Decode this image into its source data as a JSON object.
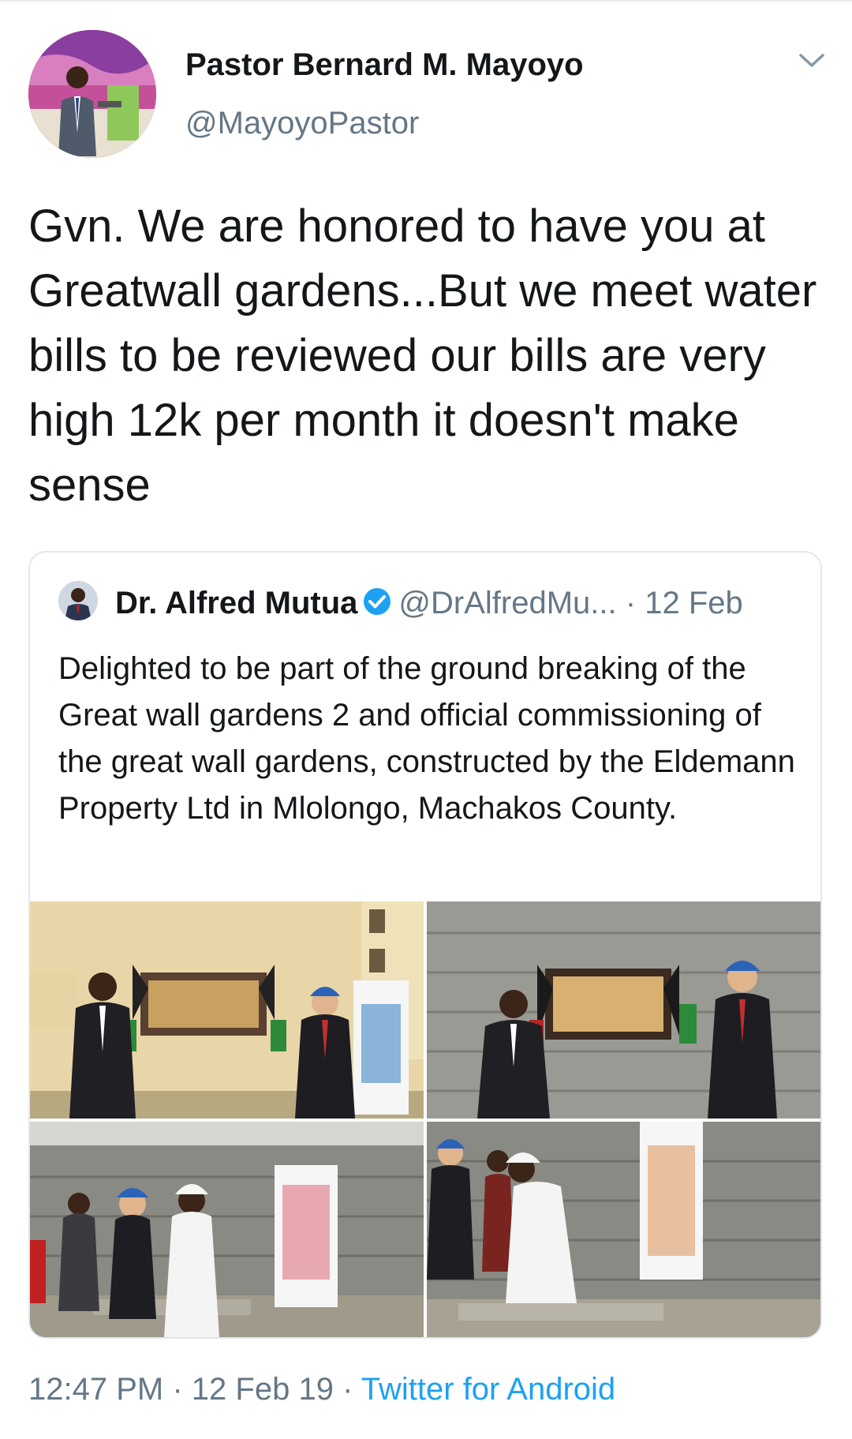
{
  "tweet": {
    "author_name": "Pastor Bernard M. Mayoyo",
    "author_handle": "@MayoyoPastor",
    "text": "Gvn. We are honored to have you at Greatwall gardens...But we meet water bills to be reviewed our bills are very high 12k per month it doesn't make sense",
    "time": "12:47 PM",
    "separator": "·",
    "date": "12 Feb 19",
    "source": "Twitter for Android",
    "menu_icon": "chevron-down-icon"
  },
  "quoted": {
    "author_name": "Dr. Alfred Mutua",
    "author_handle": "@DrAlfredMu...",
    "separator": "·",
    "date": "12 Feb",
    "verified_icon": "verified-badge-icon",
    "text": "Delighted to be part of the ground breaking of the Great wall gardens 2 and official commissioning of the great wall gardens, constructed by the Eldemann Property Ltd in Mlolongo, Machakos County.",
    "photos": [
      {
        "alt": "plaque-unveiling-photo-1"
      },
      {
        "alt": "plaque-unveiling-photo-2"
      },
      {
        "alt": "ground-breaking-photo-1"
      },
      {
        "alt": "ground-breaking-photo-2"
      }
    ]
  },
  "colors": {
    "text": "#14171a",
    "secondary": "#657786",
    "link": "#1da1f2",
    "border": "#e1e8ed"
  }
}
